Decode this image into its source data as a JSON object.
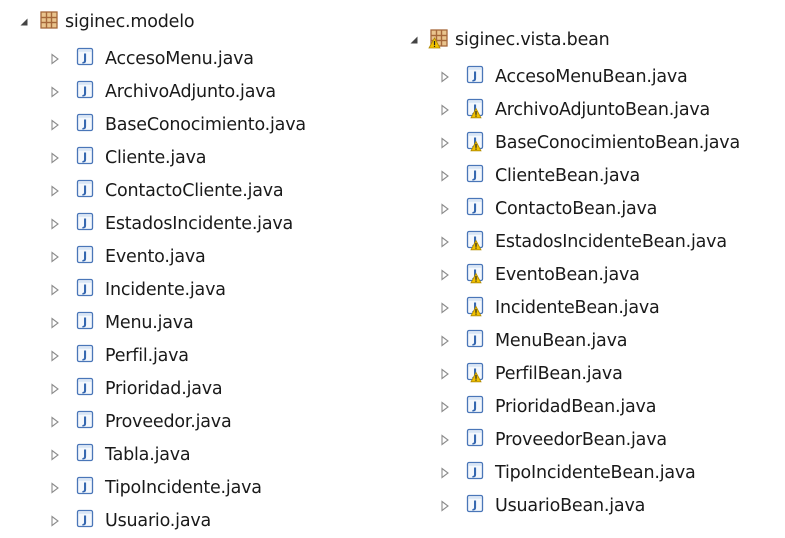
{
  "left_package": {
    "name": "siginec.modelo",
    "icon": "package-icon",
    "expanded": true,
    "files": [
      {
        "label": "AccesoMenu.java",
        "warning": false
      },
      {
        "label": "ArchivoAdjunto.java",
        "warning": false
      },
      {
        "label": "BaseConocimiento.java",
        "warning": false
      },
      {
        "label": "Cliente.java",
        "warning": false
      },
      {
        "label": "ContactoCliente.java",
        "warning": false
      },
      {
        "label": "EstadosIncidente.java",
        "warning": false
      },
      {
        "label": "Evento.java",
        "warning": false
      },
      {
        "label": "Incidente.java",
        "warning": false
      },
      {
        "label": "Menu.java",
        "warning": false
      },
      {
        "label": "Perfil.java",
        "warning": false
      },
      {
        "label": "Prioridad.java",
        "warning": false
      },
      {
        "label": "Proveedor.java",
        "warning": false
      },
      {
        "label": "Tabla.java",
        "warning": false
      },
      {
        "label": "TipoIncidente.java",
        "warning": false
      },
      {
        "label": "Usuario.java",
        "warning": false
      }
    ]
  },
  "right_package": {
    "name": "siginec.vista.bean",
    "icon": "package-warning-icon",
    "expanded": true,
    "files": [
      {
        "label": "AccesoMenuBean.java",
        "warning": false
      },
      {
        "label": "ArchivoAdjuntoBean.java",
        "warning": true
      },
      {
        "label": "BaseConocimientoBean.java",
        "warning": true
      },
      {
        "label": "ClienteBean.java",
        "warning": false
      },
      {
        "label": "ContactoBean.java",
        "warning": false
      },
      {
        "label": "EstadosIncidenteBean.java",
        "warning": true
      },
      {
        "label": "EventoBean.java",
        "warning": true
      },
      {
        "label": "IncidenteBean.java",
        "warning": true
      },
      {
        "label": "MenuBean.java",
        "warning": false
      },
      {
        "label": "PerfilBean.java",
        "warning": true
      },
      {
        "label": "PrioridadBean.java",
        "warning": false
      },
      {
        "label": "ProveedorBean.java",
        "warning": false
      },
      {
        "label": "TipoIncidenteBean.java",
        "warning": false
      },
      {
        "label": "UsuarioBean.java",
        "warning": false
      }
    ]
  },
  "colors": {
    "java_icon_border": "#4a76b8",
    "java_icon_fill": "#f4f8fd",
    "java_icon_letter": "#3567b0",
    "package_brown": "#a6683a",
    "package_fill": "#e9c48d",
    "warning_fill": "#f2c200",
    "warning_border": "#b08900",
    "expander": "#8c8c8c"
  }
}
